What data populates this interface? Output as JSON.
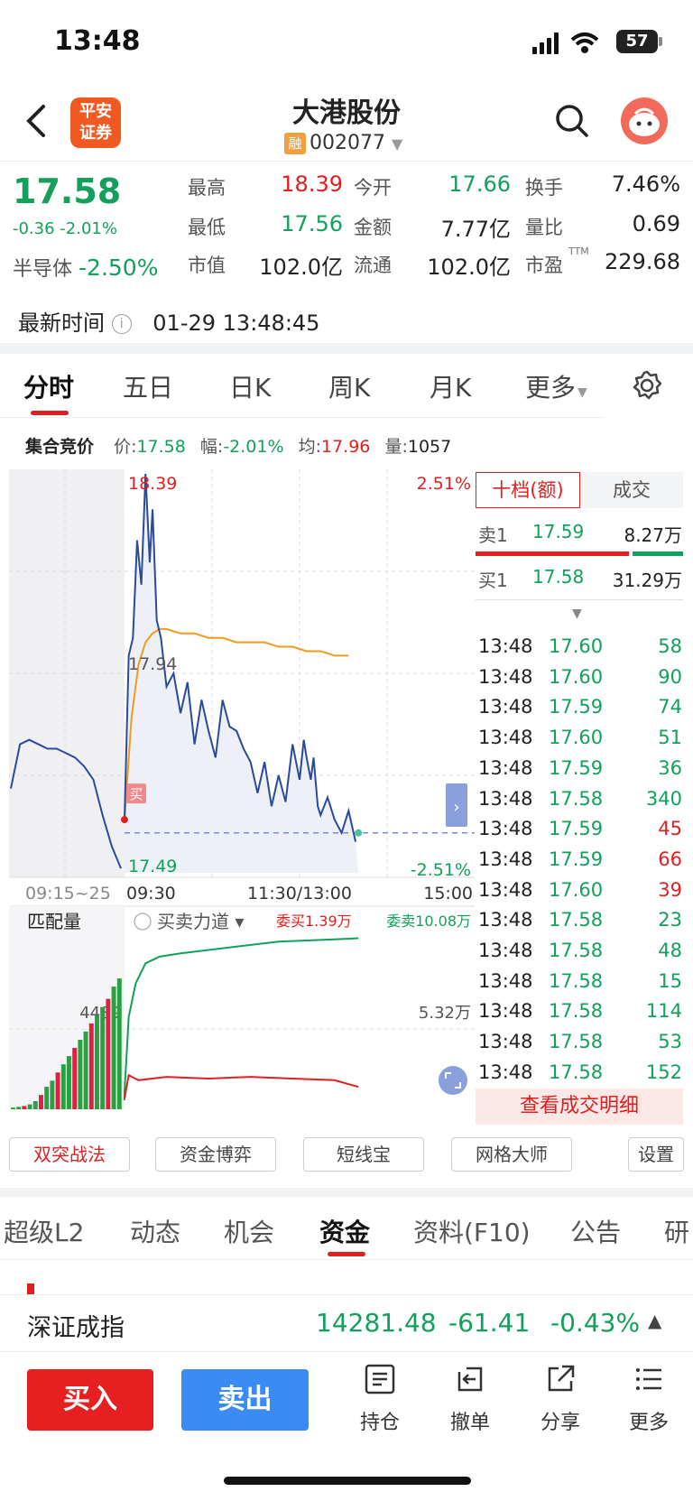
{
  "status_bar": {
    "time": "13:48",
    "battery": "57"
  },
  "header": {
    "broker_logo_text": "平安\n证券",
    "title": "大港股份",
    "badge": "融",
    "code": "002077"
  },
  "quote": {
    "price": "17.58",
    "change": "-0.36 -2.01%",
    "sector_label": "半导体",
    "sector_change": "-2.50%",
    "stats": [
      {
        "label": "最高",
        "value": "18.39",
        "color": "red"
      },
      {
        "label": "今开",
        "value": "17.66",
        "color": "green"
      },
      {
        "label": "换手",
        "value": "7.46%",
        "color": "dark"
      },
      {
        "label": "最低",
        "value": "17.56",
        "color": "green"
      },
      {
        "label": "金额",
        "value": "7.77亿",
        "color": "dark"
      },
      {
        "label": "量比",
        "value": "0.69",
        "color": "dark"
      },
      {
        "label": "市值",
        "value": "102.0亿",
        "color": "dark"
      },
      {
        "label": "流通",
        "value": "102.0亿",
        "color": "dark"
      },
      {
        "label": "市盈",
        "value": "229.68",
        "color": "dark",
        "superscript": "TTM"
      }
    ]
  },
  "update_time": {
    "label": "最新时间",
    "value": "01-29 13:48:45"
  },
  "chart_tabs": [
    {
      "label": "分时",
      "active": true
    },
    {
      "label": "五日"
    },
    {
      "label": "日K"
    },
    {
      "label": "周K"
    },
    {
      "label": "月K"
    },
    {
      "label": "更多"
    }
  ],
  "auction": {
    "label": "集合竞价",
    "price_label": "价:",
    "price": "17.58",
    "range_label": "幅:",
    "range": "-2.01%",
    "avg_label": "均:",
    "avg": "17.96",
    "vol_label": "量:",
    "vol": "1057"
  },
  "chart_labels": {
    "high": "18.39",
    "high_pct": "2.51%",
    "mid": "17.94",
    "low": "17.49",
    "low_pct": "-2.51%",
    "t_pre": "09:15~25",
    "t_open": "09:30",
    "t_mid": "11:30/13:00",
    "t_close": "15:00",
    "buy_marker": "买"
  },
  "subchart": {
    "tab1": "匹配量",
    "tab2": "买卖力道",
    "bid_label": "委买1.39万",
    "ask_label": "委卖10.08万",
    "mid_left": "4489",
    "mid_right": "5.32万"
  },
  "order_book": {
    "tab_depth": "十档(额)",
    "tab_trades": "成交",
    "sell": {
      "label": "卖1",
      "price": "17.59",
      "amount": "8.27万"
    },
    "buy": {
      "label": "买1",
      "price": "17.58",
      "amount": "31.29万"
    },
    "trades": [
      {
        "time": "13:48",
        "price": "17.60",
        "vol": "58",
        "dir": "green"
      },
      {
        "time": "13:48",
        "price": "17.60",
        "vol": "90",
        "dir": "green"
      },
      {
        "time": "13:48",
        "price": "17.59",
        "vol": "74",
        "dir": "green"
      },
      {
        "time": "13:48",
        "price": "17.60",
        "vol": "51",
        "dir": "green"
      },
      {
        "time": "13:48",
        "price": "17.59",
        "vol": "36",
        "dir": "green"
      },
      {
        "time": "13:48",
        "price": "17.58",
        "vol": "340",
        "dir": "green"
      },
      {
        "time": "13:48",
        "price": "17.59",
        "vol": "45",
        "dir": "red"
      },
      {
        "time": "13:48",
        "price": "17.59",
        "vol": "66",
        "dir": "red"
      },
      {
        "time": "13:48",
        "price": "17.60",
        "vol": "39",
        "dir": "red"
      },
      {
        "time": "13:48",
        "price": "17.58",
        "vol": "23",
        "dir": "green"
      },
      {
        "time": "13:48",
        "price": "17.58",
        "vol": "48",
        "dir": "green"
      },
      {
        "time": "13:48",
        "price": "17.58",
        "vol": "15",
        "dir": "green"
      },
      {
        "time": "13:48",
        "price": "17.58",
        "vol": "114",
        "dir": "green"
      },
      {
        "time": "13:48",
        "price": "17.58",
        "vol": "53",
        "dir": "green"
      },
      {
        "time": "13:48",
        "price": "17.58",
        "vol": "152",
        "dir": "green"
      }
    ],
    "detail_button": "查看成交明细"
  },
  "tools": [
    "双突战法",
    "资金博弈",
    "短线宝",
    "网格大师",
    "设置"
  ],
  "section_tabs": [
    {
      "label": "超级L2"
    },
    {
      "label": "动态"
    },
    {
      "label": "机会"
    },
    {
      "label": "资金",
      "active": true
    },
    {
      "label": "资料(F10)"
    },
    {
      "label": "公告"
    },
    {
      "label": "研"
    }
  ],
  "index_bar": {
    "name": "深证成指",
    "value": "14281.48",
    "change": "-61.41",
    "pct": "-0.43%"
  },
  "bottom": {
    "buy": "买入",
    "sell": "卖出",
    "actions": [
      {
        "label": "持仓",
        "icon": "holdings-icon"
      },
      {
        "label": "撤单",
        "icon": "cancel-order-icon"
      },
      {
        "label": "分享",
        "icon": "share-icon"
      },
      {
        "label": "更多",
        "icon": "more-menu-icon"
      }
    ]
  },
  "colors": {
    "up": "#e02020",
    "down": "#12a05a",
    "price_line": "#2a4a9a",
    "avg_line": "#f39a1e",
    "sell_btn": "#3b8bf5"
  },
  "chart_data": {
    "type": "line",
    "ylim": [
      17.49,
      18.39
    ],
    "reference": 17.94,
    "pre_auction": [
      17.68,
      17.78,
      17.79,
      17.78,
      17.77,
      17.77,
      17.76,
      17.75,
      17.73,
      17.7,
      17.62,
      17.55,
      17.5
    ],
    "series": [
      {
        "x": [
          0,
          3,
          6,
          9,
          12,
          15,
          18,
          20,
          23,
          26,
          30,
          35,
          40,
          45,
          50,
          55,
          60,
          65,
          70,
          75,
          80,
          85,
          90,
          95,
          100,
          105,
          110,
          115,
          120,
          125,
          128,
          130,
          133,
          135,
          138,
          140,
          145,
          150,
          155,
          160,
          165,
          170,
          175,
          180,
          185,
          190,
          195,
          200,
          205,
          210,
          215,
          220,
          225,
          230,
          235,
          240,
          245,
          250
        ],
        "price": [
          17.61,
          17.98,
          18.02,
          18.24,
          18.14,
          18.39,
          18.19,
          18.31,
          18.06,
          18.02,
          17.91,
          17.94,
          17.85,
          17.92,
          17.78,
          17.88,
          17.81,
          17.75,
          17.88,
          17.82,
          17.81,
          17.77,
          17.74,
          17.67,
          17.74,
          17.64,
          17.71,
          17.65,
          17.78,
          17.7,
          17.79,
          17.75,
          17.7,
          17.75,
          17.64,
          17.62,
          17.66,
          17.61,
          17.58,
          17.63,
          17.56,
          17.62,
          17.58,
          17.58,
          17.58,
          17.58,
          17.58,
          17.58,
          17.58,
          17.58,
          17.58,
          17.58,
          17.58,
          17.58,
          17.58,
          17.58,
          17.58,
          17.58
        ]
      },
      {
        "x": [
          0,
          5,
          10,
          15,
          20,
          25,
          30,
          40,
          50,
          60,
          70,
          80,
          90,
          100,
          110,
          120,
          130,
          140,
          150,
          160,
          170,
          180,
          190,
          200,
          210,
          220,
          230,
          240,
          250
        ],
        "avg": [
          17.61,
          17.84,
          17.96,
          18.01,
          18.03,
          18.04,
          18.04,
          18.03,
          18.03,
          18.02,
          18.02,
          18.01,
          18.01,
          18.01,
          18.0,
          18.0,
          17.99,
          17.99,
          17.98,
          17.98,
          17.97,
          17.97,
          17.96,
          17.96,
          17.96,
          17.96,
          17.96,
          17.96,
          17.96
        ]
      }
    ],
    "x_total": 250,
    "x_now": 167,
    "volume_pre": [
      4,
      6,
      8,
      12,
      20,
      35,
      55,
      70,
      90,
      110,
      130,
      150,
      170,
      190,
      210,
      230,
      250,
      270,
      300,
      320
    ],
    "strength": {
      "ylim": [
        0,
        1
      ]
    }
  }
}
